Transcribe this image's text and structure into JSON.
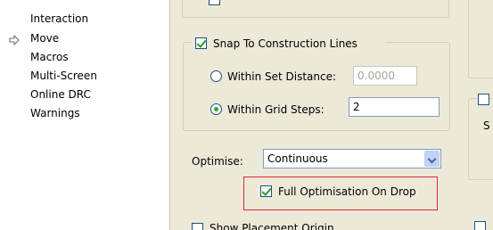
{
  "nav": {
    "items": [
      {
        "label": "Interaction"
      },
      {
        "label": "Move"
      },
      {
        "label": "Macros"
      },
      {
        "label": "Multi-Screen"
      },
      {
        "label": "Online DRC"
      },
      {
        "label": "Warnings"
      }
    ],
    "selected_index": 1
  },
  "snap": {
    "label": "Snap To Construction Lines",
    "checked": true,
    "within_distance_label": "Within Set Distance:",
    "within_distance_value": "0.0000",
    "within_grid_label": "Within Grid Steps:",
    "within_grid_value": "2",
    "selected_option": "within_grid"
  },
  "optimise": {
    "label": "Optimise:",
    "value": "Continuous"
  },
  "full_optimisation": {
    "label": "Full Optimisation On Drop",
    "checked": true
  },
  "bottom": {
    "show_placement_origin_label": "Show Placement Origin"
  },
  "right_column": {
    "partial_text": "S"
  },
  "colors": {
    "panel_bg": "#ece9d8",
    "highlight_border": "#e0282a",
    "check_green": "#21a121"
  }
}
